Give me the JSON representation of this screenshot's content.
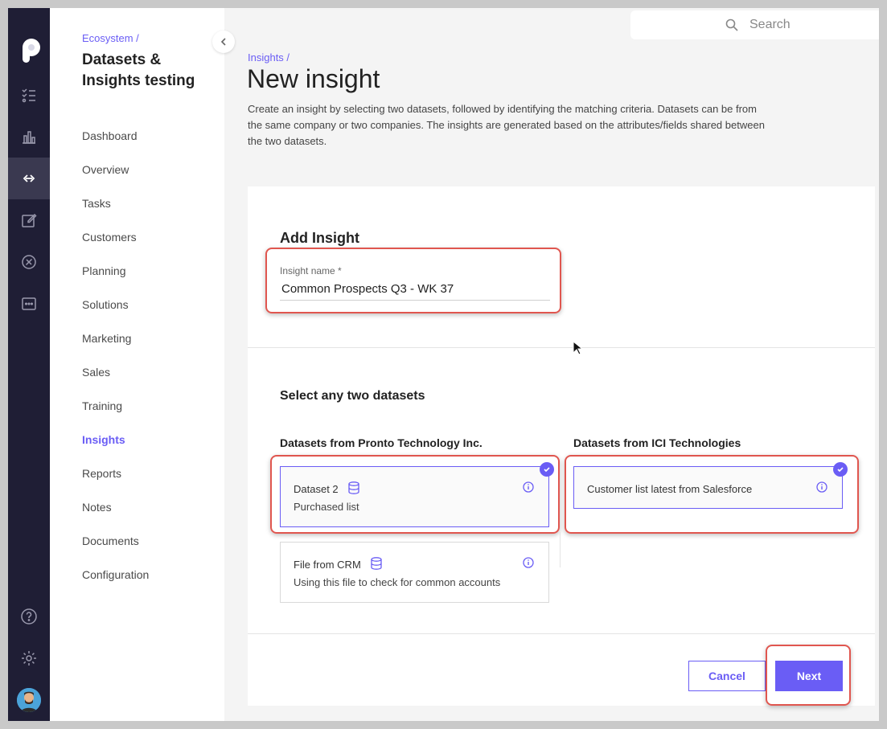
{
  "colors": {
    "accent": "#6a5df5",
    "rail_bg": "#1f1e35",
    "highlight": "#e0564f"
  },
  "rail": {
    "icons": [
      "logo-icon",
      "tasks-icon",
      "chart-icon",
      "link-icon",
      "edit-icon",
      "cancel-circle-icon",
      "more-icon",
      "help-icon",
      "settings-icon",
      "avatar"
    ],
    "active": "link-icon"
  },
  "sidebar": {
    "breadcrumb": "Ecosystem /",
    "title": "Datasets & Insights testing",
    "items": [
      {
        "label": "Dashboard"
      },
      {
        "label": "Overview"
      },
      {
        "label": "Tasks"
      },
      {
        "label": "Customers"
      },
      {
        "label": "Planning"
      },
      {
        "label": "Solutions"
      },
      {
        "label": "Marketing"
      },
      {
        "label": "Sales"
      },
      {
        "label": "Training"
      },
      {
        "label": "Insights",
        "active": true
      },
      {
        "label": "Reports"
      },
      {
        "label": "Notes"
      },
      {
        "label": "Documents"
      },
      {
        "label": "Configuration"
      }
    ]
  },
  "search": {
    "placeholder": "Search"
  },
  "main": {
    "breadcrumb": "Insights /",
    "title": "New insight",
    "description": "Create an insight by selecting two datasets, followed by identifying the matching criteria. Datasets can be from the same company or two companies. The insights are generated based on the attributes/fields shared between the two datasets."
  },
  "form": {
    "heading": "Add Insight",
    "name_label": "Insight name *",
    "name_value": "Common Prospects Q3 - WK 37",
    "select_heading": "Select any two datasets",
    "left_column": {
      "title": "Datasets from Pronto Technology Inc.",
      "datasets": [
        {
          "name": "Dataset 2",
          "subtitle": "Purchased list",
          "selected": true
        },
        {
          "name": "File from CRM",
          "subtitle": "Using this file to check for common accounts",
          "selected": false
        }
      ]
    },
    "right_column": {
      "title": "Datasets from ICI Technologies",
      "datasets": [
        {
          "name": "Customer list latest from Salesforce",
          "selected": true
        }
      ]
    },
    "cancel_label": "Cancel",
    "next_label": "Next"
  }
}
